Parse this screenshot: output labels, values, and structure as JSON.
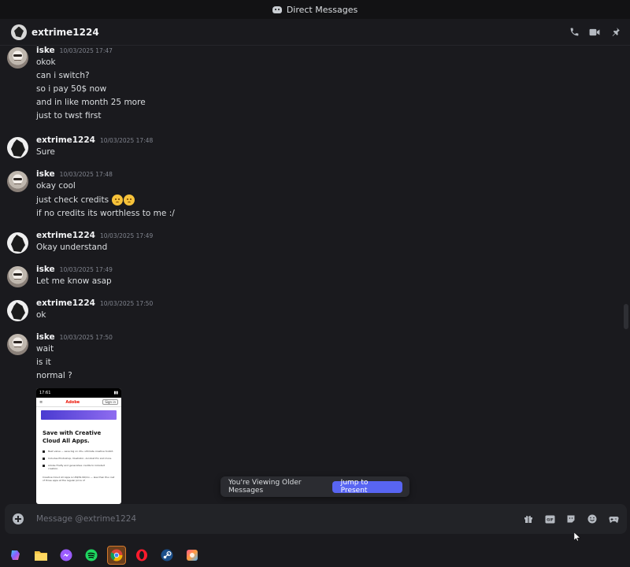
{
  "window": {
    "title": "Direct Messages"
  },
  "header": {
    "name": "extrime1224"
  },
  "messages": [
    {
      "author": "iske",
      "time": "10/03/2025 17:47",
      "lines": [
        "okok",
        "can i switch?",
        "so i pay 50$ now",
        "and in like month 25 more",
        "just to twst first"
      ]
    },
    {
      "author": "extrime1224",
      "time": "10/03/2025 17:48",
      "lines": [
        "Sure"
      ]
    },
    {
      "author": "iske",
      "time": "10/03/2025 17:48",
      "lines": [
        "okay cool",
        "just check credits",
        "if no credits its worthless to me :/"
      ]
    },
    {
      "author": "extrime1224",
      "time": "10/03/2025 17:49",
      "lines": [
        "Okay understand"
      ]
    },
    {
      "author": "iske",
      "time": "10/03/2025 17:49",
      "lines": [
        "Let me know asap"
      ]
    },
    {
      "author": "extrime1224",
      "time": "10/03/2025 17:50",
      "lines": [
        "ok"
      ]
    },
    {
      "author": "iske",
      "time": "10/03/2025 17:50",
      "lines": [
        "wait",
        "is it",
        "normal ?"
      ]
    }
  ],
  "attachment": {
    "status_time": "17:61",
    "brand": "Adobe",
    "signin": "Sign in",
    "heading": "Save with Creative Cloud All Apps.",
    "bullets": [
      "Best value — save big on 20+ ultimate creative toolkit.",
      "Includes Photoshop, Illustrator, Acrobat Pro and more.",
      "Adobe Firefly and generative credits to kickstart creation."
    ],
    "footer": "Creative Cloud All Apps is US$59.99/mo — less than the cost of three apps at the regular price of"
  },
  "older_bar": {
    "text": "You're Viewing Older Messages",
    "jump_label": "Jump to Present"
  },
  "composer": {
    "placeholder": "Message @extrime1224"
  },
  "icons": {
    "header": [
      "phone-icon",
      "video-icon",
      "pin-icon"
    ],
    "composer": [
      "gift-icon",
      "gif-icon",
      "sticker-icon",
      "emoji-icon",
      "activity-icon"
    ],
    "taskbar": [
      "copilot-icon",
      "file-explorer-icon",
      "messenger-icon",
      "spotify-icon",
      "chrome-icon",
      "opera-icon",
      "steam-icon",
      "photos-icon"
    ]
  },
  "colors": {
    "accent": "#5865f2",
    "background": "#1a1a1e"
  }
}
